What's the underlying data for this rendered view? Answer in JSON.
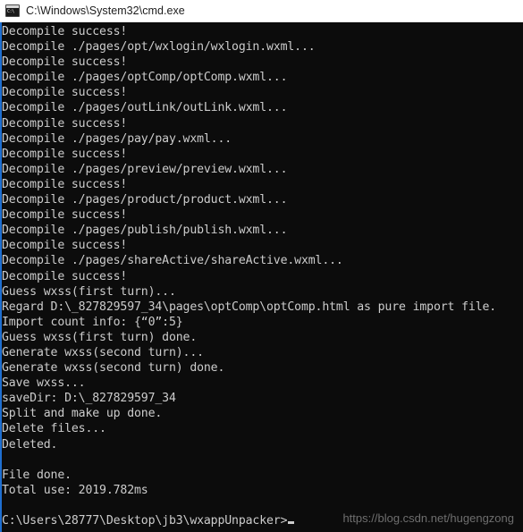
{
  "window": {
    "title": "C:\\Windows\\System32\\cmd.exe",
    "icon": "cmd-console-icon",
    "icon_glyph": "C:\\",
    "titlebar_bg": "#ffffff",
    "titlebar_fg": "#1d1d1d",
    "console_bg": "#0c0c0c",
    "console_fg": "#cccccc",
    "left_edge_color": "#1f6fd0"
  },
  "console": {
    "lines": [
      "Decompile success!",
      "Decompile ./pages/opt/wxlogin/wxlogin.wxml...",
      "Decompile success!",
      "Decompile ./pages/optComp/optComp.wxml...",
      "Decompile success!",
      "Decompile ./pages/outLink/outLink.wxml...",
      "Decompile success!",
      "Decompile ./pages/pay/pay.wxml...",
      "Decompile success!",
      "Decompile ./pages/preview/preview.wxml...",
      "Decompile success!",
      "Decompile ./pages/product/product.wxml...",
      "Decompile success!",
      "Decompile ./pages/publish/publish.wxml...",
      "Decompile success!",
      "Decompile ./pages/shareActive/shareActive.wxml...",
      "Decompile success!",
      "Guess wxss(first turn)...",
      "Regard D:\\_827829597_34\\pages\\optComp\\optComp.html as pure import file.",
      "Import count info: {“0”:5}",
      "Guess wxss(first turn) done.",
      "Generate wxss(second turn)...",
      "Generate wxss(second turn) done.",
      "Save wxss...",
      "saveDir: D:\\_827829597_34",
      "Split and make up done.",
      "Delete files...",
      "Deleted.",
      "",
      "File done.",
      "Total use: 2019.782ms",
      ""
    ],
    "prompt": "C:\\Users\\28777\\Desktop\\jb3\\wxappUnpacker>",
    "cursor_visible": true
  },
  "watermark": {
    "text": "https://blog.csdn.net/hugengzong"
  }
}
